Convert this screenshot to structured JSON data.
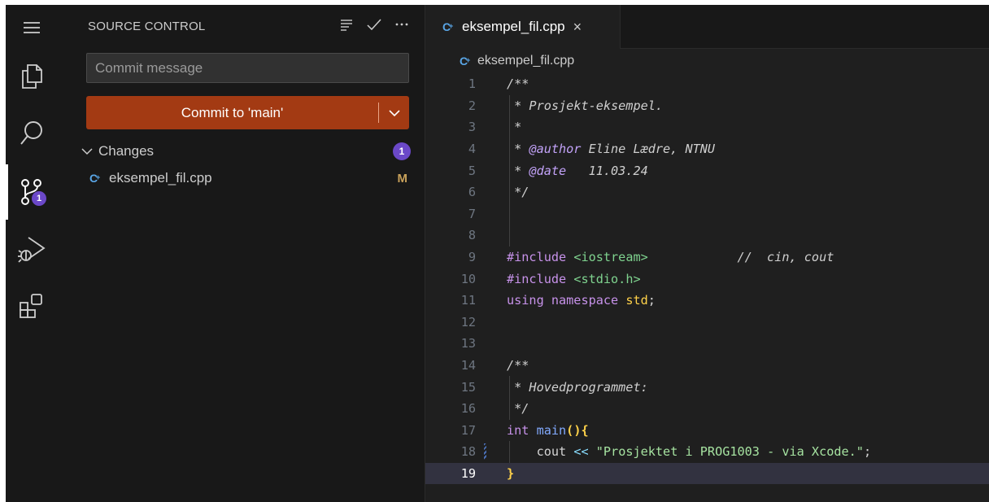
{
  "activity_bar": {
    "items": [
      {
        "icon": "menu-icon"
      },
      {
        "icon": "explorer-icon"
      },
      {
        "icon": "search-icon"
      },
      {
        "icon": "source-control-icon",
        "badge": "1",
        "active": true
      },
      {
        "icon": "run-debug-icon"
      },
      {
        "icon": "extensions-icon"
      }
    ]
  },
  "sidebar": {
    "title": "SOURCE CONTROL",
    "actions": [
      "view-as-list-icon",
      "commit-check-icon",
      "more-icon"
    ],
    "commit_placeholder": "Commit message",
    "commit_button_label": "Commit to 'main'",
    "changes": {
      "label": "Changes",
      "count": "1",
      "files": [
        {
          "name": "eksempel_fil.cpp",
          "status": "M"
        }
      ]
    }
  },
  "editor": {
    "tab": {
      "name": "eksempel_fil.cpp",
      "close": "×"
    },
    "breadcrumb": "eksempel_fil.cpp",
    "current_line": 19,
    "lines": [
      {
        "n": "1",
        "text": "/**"
      },
      {
        "n": "2",
        "text": " * Prosjekt-eksempel."
      },
      {
        "n": "3",
        "text": " *"
      },
      {
        "n": "4",
        "tag": "@author",
        "text": " Eline Lædre, NTNU"
      },
      {
        "n": "5",
        "tag": "@date",
        "text": "   11.03.24"
      },
      {
        "n": "6",
        "text": " */"
      },
      {
        "n": "7",
        "text": ""
      },
      {
        "n": "8",
        "text": ""
      },
      {
        "n": "9",
        "directive": "#include",
        "header": "<iostream>",
        "comment": "//  cin, cout"
      },
      {
        "n": "10",
        "directive": "#include",
        "header": "<stdio.h>"
      },
      {
        "n": "11",
        "kw1": "using",
        "kw2": "namespace",
        "ns": "std",
        "end": ";"
      },
      {
        "n": "12",
        "text": ""
      },
      {
        "n": "13",
        "text": ""
      },
      {
        "n": "14",
        "text": "/**"
      },
      {
        "n": "15",
        "text": " * Hovedprogrammet:"
      },
      {
        "n": "16",
        "text": " */"
      },
      {
        "n": "17",
        "kw": "int",
        "fn": "main",
        "parens": "()",
        "brace": "{"
      },
      {
        "n": "18",
        "ident": "cout",
        "op": "<<",
        "str": "\"Prosjektet i PROG1003 - via Xcode.\"",
        "end": ";"
      },
      {
        "n": "19",
        "brace": "}"
      }
    ]
  }
}
